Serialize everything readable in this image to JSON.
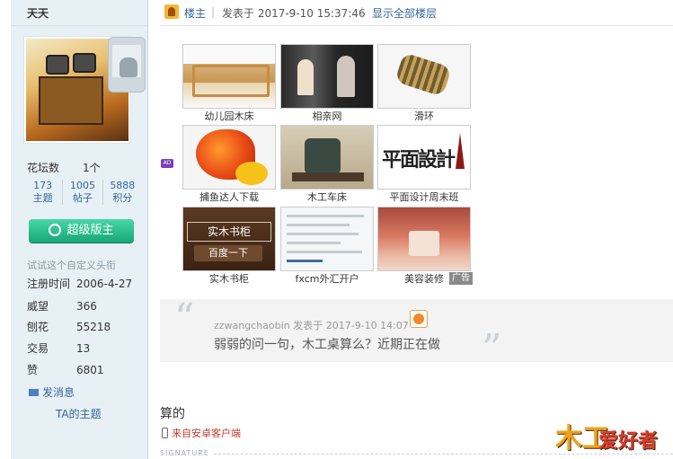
{
  "sidebar": {
    "username": "天天",
    "forum_count_label": "花坛数",
    "forum_count_value": "1个",
    "stats": [
      {
        "num": "173",
        "label": "主题"
      },
      {
        "num": "1005",
        "label": "帖子"
      },
      {
        "num": "5888",
        "label": "积分"
      }
    ],
    "super_mod_label": "超级版主",
    "custom_title": "试试这个自定义头衔",
    "info": [
      {
        "key": "注册时间",
        "value": "2006-4-27"
      },
      {
        "key": "威望",
        "value": "366"
      },
      {
        "key": "刨花",
        "value": "55218"
      },
      {
        "key": "交易",
        "value": "13"
      },
      {
        "key": "赞",
        "value": "6801"
      }
    ],
    "send_message": "发消息",
    "their_topics": "TA的主题"
  },
  "header": {
    "owner_label": "楼主",
    "posted_at": "发表于 2017-9-10 15:37:46",
    "show_all": "显示全部楼层"
  },
  "ad_badge": "AD",
  "ads": [
    {
      "caption": "幼儿园木床",
      "icon": "wooden-bed-image"
    },
    {
      "caption": "相亲网",
      "icon": "dating-couple-image"
    },
    {
      "caption": "滑环",
      "icon": "slip-ring-image"
    },
    {
      "caption": "捕鱼达人下载",
      "icon": "fish-game-image"
    },
    {
      "caption": "木工车床",
      "icon": "wood-lathe-image"
    },
    {
      "caption": "平面设计周末班",
      "icon": "graphic-design-image",
      "art_text": "平面設計"
    },
    {
      "caption": "实木书柜",
      "icon": "bookcase-image",
      "art_title": "实木书柜",
      "art_sub": "百度一下"
    },
    {
      "caption": "fxcm外汇开户",
      "icon": "forex-screen-image"
    },
    {
      "caption": "美容装修",
      "icon": "beauty-salon-image"
    }
  ],
  "ad_label": "广告",
  "quote": {
    "author": "zzwangchaobin",
    "posted": "发表于 2017-9-10 14:07",
    "text": "弱弱的问一句，木工桌算么？近期正在做"
  },
  "reply": {
    "text": "算的",
    "from_mobile": "来自安卓客户端"
  },
  "signature_label": "SIGNATURE",
  "logo": {
    "part1": "木工",
    "part2": "爱好者"
  },
  "colors": {
    "link": "#336699",
    "super_btn": "#17a775",
    "mobile_red": "#c0392b"
  }
}
